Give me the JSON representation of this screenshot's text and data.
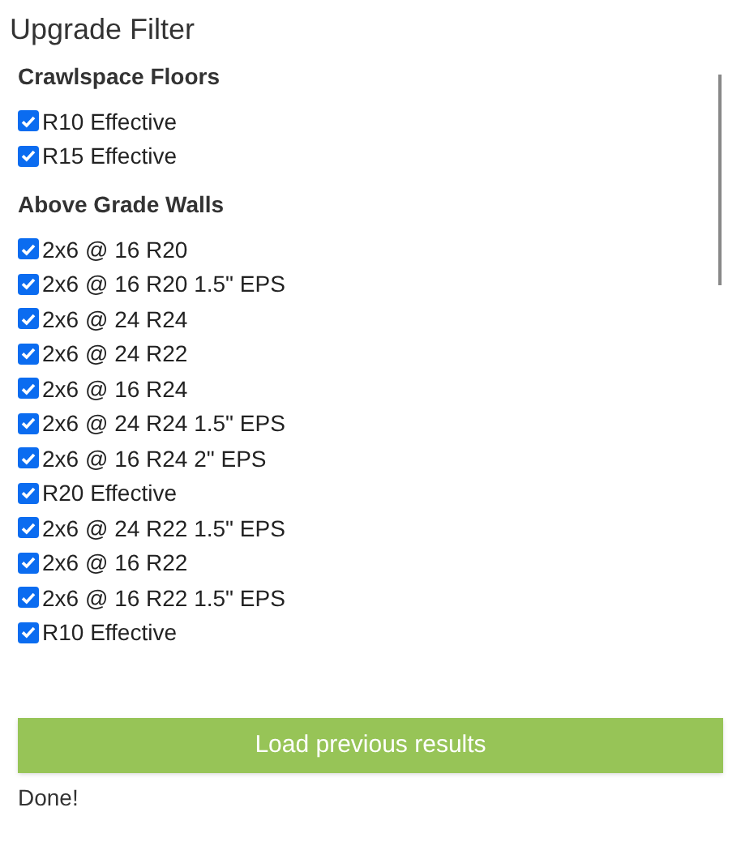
{
  "title": "Upgrade Filter",
  "groups": [
    {
      "heading": "Crawlspace Floors",
      "items": [
        {
          "label": "R10 Effective",
          "checked": true
        },
        {
          "label": "R15 Effective",
          "checked": true
        }
      ]
    },
    {
      "heading": "Above Grade Walls",
      "items": [
        {
          "label": "2x6 @ 16 R20",
          "checked": true
        },
        {
          "label": "2x6 @ 16 R20 1.5\" EPS",
          "checked": true
        },
        {
          "label": "2x6 @ 24 R24",
          "checked": true
        },
        {
          "label": "2x6 @ 24 R22",
          "checked": true
        },
        {
          "label": "2x6 @ 16 R24",
          "checked": true
        },
        {
          "label": "2x6 @ 24 R24 1.5\" EPS",
          "checked": true
        },
        {
          "label": "2x6 @ 16 R24 2\" EPS",
          "checked": true
        },
        {
          "label": "R20 Effective",
          "checked": true
        },
        {
          "label": "2x6 @ 24 R22 1.5\" EPS",
          "checked": true
        },
        {
          "label": "2x6 @ 16 R22",
          "checked": true
        },
        {
          "label": "2x6 @ 16 R22 1.5\" EPS",
          "checked": true
        },
        {
          "label": "R10 Effective",
          "checked": true
        }
      ]
    }
  ],
  "button": "Load previous results",
  "status": "Done!"
}
